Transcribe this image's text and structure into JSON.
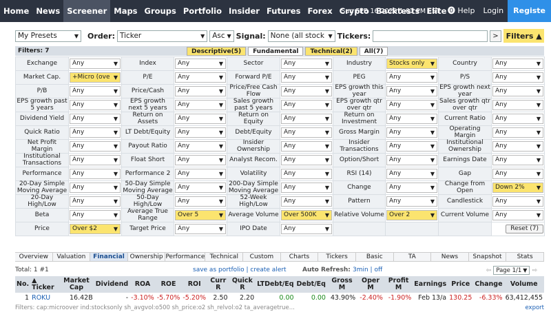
{
  "nav": {
    "items": [
      "Home",
      "News",
      "Screener",
      "Maps",
      "Groups",
      "Portfolio",
      "Insider",
      "Futures",
      "Forex",
      "Crypto",
      "Backtests",
      "Elite"
    ],
    "active": "Screener",
    "datetime": "Sun FEB 16 2020 1:07 PM EST",
    "help": "Help",
    "login": "Login",
    "register": "Registe"
  },
  "controls": {
    "presets": "My Presets",
    "order_label": "Order:",
    "order": "Ticker",
    "direction": "Asc",
    "signal_label": "Signal:",
    "signal": "None (all stock",
    "tickers_label": "Tickers:",
    "go": ">",
    "filters_btn": "Filters ▲"
  },
  "filters_count": "Filters: 7",
  "filter_tabs": [
    "Descriptive(5)",
    "Fundamental",
    "Technical(2)",
    "All(7)"
  ],
  "filter_tabs_highlight": [
    true,
    false,
    true,
    false
  ],
  "rows": [
    [
      [
        "Exchange",
        "Any",
        0
      ],
      [
        "Index",
        "Any",
        0
      ],
      [
        "Sector",
        "Any",
        0
      ],
      [
        "Industry",
        "Stocks only",
        1
      ],
      [
        "Country",
        "Any",
        0
      ]
    ],
    [
      [
        "Market Cap.",
        "+Micro (ove",
        1
      ],
      [
        "P/E",
        "Any",
        0
      ],
      [
        "Forward P/E",
        "Any",
        0
      ],
      [
        "PEG",
        "Any",
        0
      ],
      [
        "P/S",
        "Any",
        0
      ]
    ],
    [
      [
        "P/B",
        "Any",
        0
      ],
      [
        "Price/Cash",
        "Any",
        0
      ],
      [
        "Price/Free Cash Flow",
        "Any",
        0
      ],
      [
        "EPS growth this year",
        "Any",
        0
      ],
      [
        "EPS growth next year",
        "Any",
        0
      ]
    ],
    [
      [
        "EPS growth past 5 years",
        "Any",
        0
      ],
      [
        "EPS growth next 5 years",
        "Any",
        0
      ],
      [
        "Sales growth past 5 years",
        "Any",
        0
      ],
      [
        "EPS growth qtr over qtr",
        "Any",
        0
      ],
      [
        "Sales growth qtr over qtr",
        "Any",
        0
      ]
    ],
    [
      [
        "Dividend Yield",
        "Any",
        0
      ],
      [
        "Return on Assets",
        "Any",
        0
      ],
      [
        "Return on Equity",
        "Any",
        0
      ],
      [
        "Return on Investment",
        "Any",
        0
      ],
      [
        "Current Ratio",
        "Any",
        0
      ]
    ],
    [
      [
        "Quick Ratio",
        "Any",
        0
      ],
      [
        "LT Debt/Equity",
        "Any",
        0
      ],
      [
        "Debt/Equity",
        "Any",
        0
      ],
      [
        "Gross Margin",
        "Any",
        0
      ],
      [
        "Operating Margin",
        "Any",
        0
      ]
    ],
    [
      [
        "Net Profit Margin",
        "Any",
        0
      ],
      [
        "Payout Ratio",
        "Any",
        0
      ],
      [
        "Insider Ownership",
        "Any",
        0
      ],
      [
        "Insider Transactions",
        "Any",
        0
      ],
      [
        "Institutional Ownership",
        "Any",
        0
      ]
    ],
    [
      [
        "Institutional Transactions",
        "Any",
        0
      ],
      [
        "Float Short",
        "Any",
        0
      ],
      [
        "Analyst Recom.",
        "Any",
        0
      ],
      [
        "Option/Short",
        "Any",
        0
      ],
      [
        "Earnings Date",
        "Any",
        0
      ]
    ],
    [
      [
        "Performance",
        "Any",
        0
      ],
      [
        "Performance 2",
        "Any",
        0
      ],
      [
        "Volatility",
        "Any",
        0
      ],
      [
        "RSI (14)",
        "Any",
        0
      ],
      [
        "Gap",
        "Any",
        0
      ]
    ],
    [
      [
        "20-Day Simple Moving Average",
        "Any",
        0
      ],
      [
        "50-Day Simple Moving Average",
        "Any",
        0
      ],
      [
        "200-Day Simple Moving Average",
        "Any",
        0
      ],
      [
        "Change",
        "Any",
        0
      ],
      [
        "Change from Open",
        "Down 2%",
        1
      ]
    ],
    [
      [
        "20-Day High/Low",
        "Any",
        0
      ],
      [
        "50-Day High/Low",
        "Any",
        0
      ],
      [
        "52-Week High/Low",
        "Any",
        0
      ],
      [
        "Pattern",
        "Any",
        0
      ],
      [
        "Candlestick",
        "Any",
        0
      ]
    ],
    [
      [
        "Beta",
        "Any",
        0
      ],
      [
        "Average True Range",
        "Over 5",
        1
      ],
      [
        "Average Volume",
        "Over 500K",
        1
      ],
      [
        "Relative Volume",
        "Over 2",
        1
      ],
      [
        "Current Volume",
        "Any",
        0
      ]
    ],
    [
      [
        "Price",
        "Over $2",
        1
      ],
      [
        "Target Price",
        "Any",
        0
      ],
      [
        "IPO Date",
        "Any",
        0
      ],
      [
        "",
        null,
        0
      ],
      [
        "",
        "Reset (7)",
        2
      ]
    ]
  ],
  "view_tabs": [
    "Overview",
    "Valuation",
    "Financial",
    "Ownership",
    "Performance",
    "Technical",
    "Custom",
    "Charts",
    "Tickers",
    "Basic",
    "TA",
    "News",
    "Snapshot",
    "Stats"
  ],
  "view_active": "Financial",
  "total": "Total: 1 #1",
  "save_links": "save as portfolio | create alert",
  "auto_refresh_label": "Auto Refresh:",
  "auto_refresh": "3min | off",
  "page": "Page 1/1",
  "columns": [
    "No.",
    "▲ Ticker",
    "Market Cap",
    "Dividend",
    "ROA",
    "ROE",
    "ROI",
    "Curr R",
    "Quick R",
    "LTDebt/Eq",
    "Debt/Eq",
    "Gross M",
    "Oper M",
    "Profit M",
    "Earnings",
    "Price",
    "Change",
    "Volume"
  ],
  "result_rows": [
    [
      "1",
      "ROKU",
      "16.42B",
      "-",
      "-3.10%",
      "-5.70%",
      "-5.20%",
      "2.50",
      "2.20",
      "0.00",
      "0.00",
      "43.90%",
      "-2.40%",
      "-1.90%",
      "Feb 13/a",
      "130.25",
      "-6.33%",
      "63,412,455"
    ]
  ],
  "result_colors": [
    "",
    "link",
    "",
    "",
    "neg",
    "neg",
    "neg",
    "",
    "",
    "pos",
    "pos",
    "",
    "neg",
    "neg",
    "",
    "neg",
    "neg",
    ""
  ],
  "footer_filters": "Filters: cap:microover ind:stocksonly sh_avgvol:o500 sh_price:o2 sh_relvol:o2 ta_averagetrue...",
  "export": "export",
  "colors": {
    "nav_bg": "#2c3340",
    "highlight": "#fbe46f",
    "link": "#1a5fb4",
    "negative": "#cc2222",
    "positive": "#1a8a1a",
    "register": "#2f90e8"
  }
}
